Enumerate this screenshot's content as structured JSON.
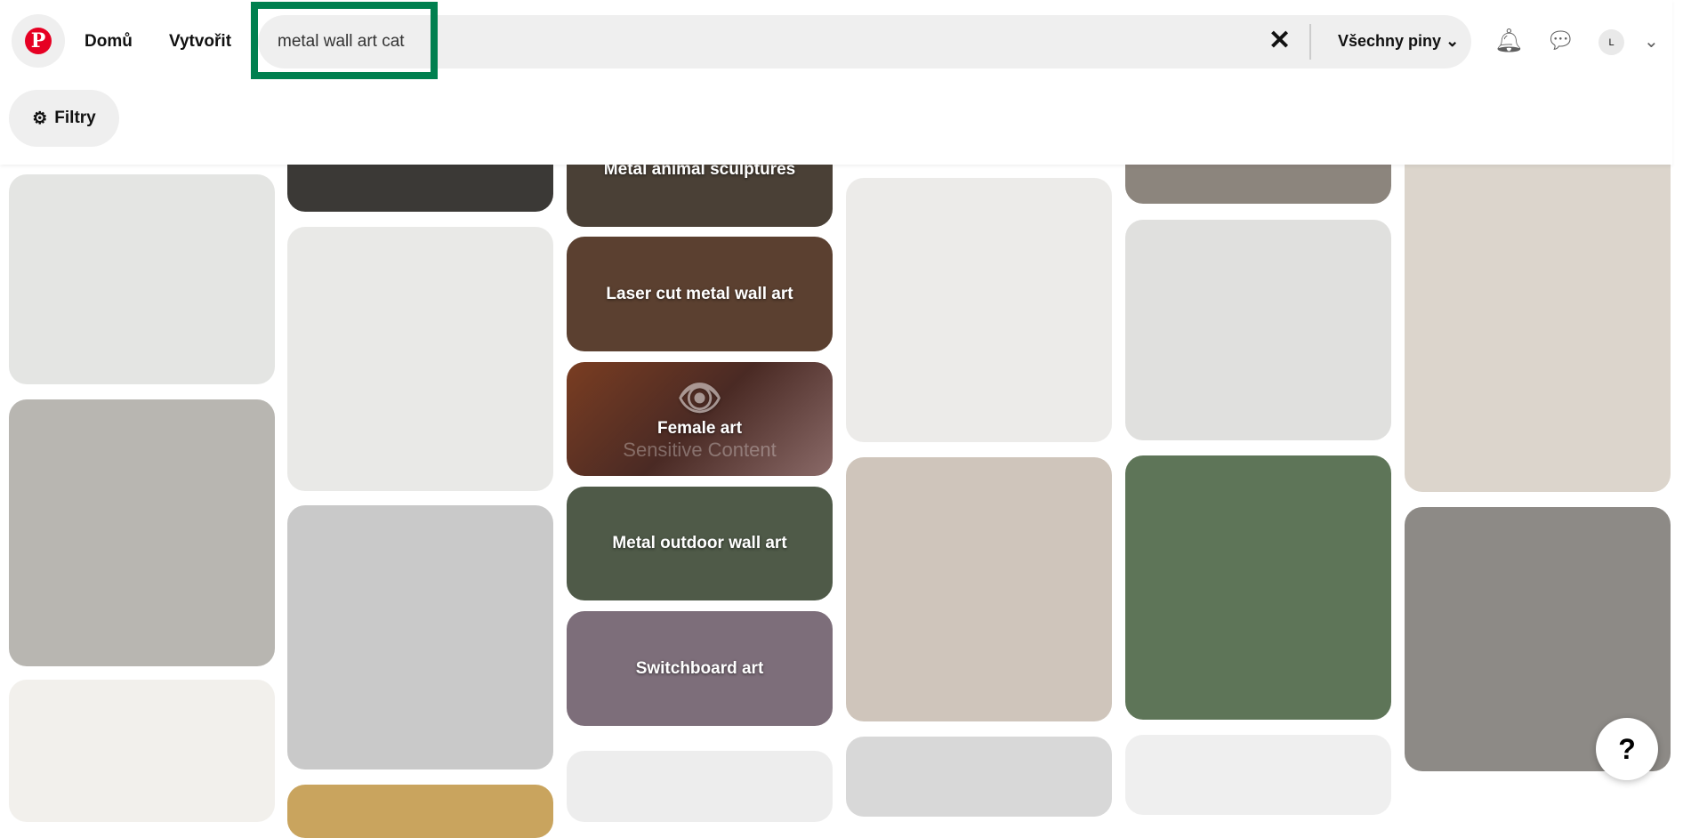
{
  "header": {
    "logo": "Pinterest",
    "nav": [
      "Domů",
      "Vytvořit"
    ],
    "search_value": "metal wall art cat",
    "scope_label": "Všechny piny",
    "avatar_initial": "L"
  },
  "filters_label": "Filtry",
  "categories": [
    "Metal animal sculptures",
    "Laser cut metal wall art",
    "Female art",
    "Metal outdoor wall art",
    "Switchboard art"
  ],
  "sensitive_label": "Sensitive Content",
  "help_label": "?",
  "colors": {
    "brand": "#e60023",
    "focus_outline": "#00804f"
  }
}
